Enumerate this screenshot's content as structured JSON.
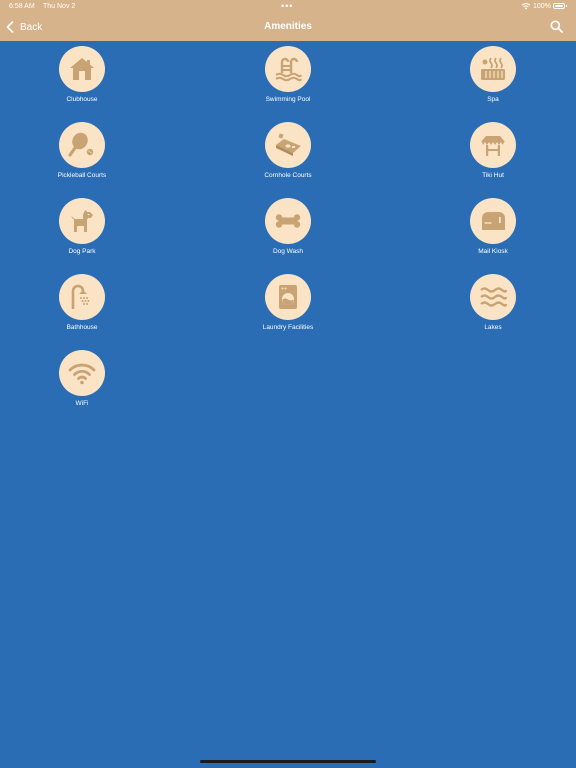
{
  "status": {
    "time": "6:58 AM",
    "date": "Thu Nov 2",
    "battery": "100%"
  },
  "nav": {
    "back_label": "Back",
    "title": "Amenities"
  },
  "colors": {
    "header_bg": "#d6b38a",
    "page_bg": "#2a6db5",
    "icon_circle": "#fbe3c6",
    "icon_fill": "#c8a374"
  },
  "amenities": [
    {
      "label": "Clubhouse",
      "icon": "house-icon"
    },
    {
      "label": "Swimming Pool",
      "icon": "pool-icon"
    },
    {
      "label": "Spa",
      "icon": "hot-tub-icon"
    },
    {
      "label": "Pickleball Courts",
      "icon": "paddle-icon"
    },
    {
      "label": "Cornhole Courts",
      "icon": "cornhole-icon"
    },
    {
      "label": "Tiki Hut",
      "icon": "hut-icon"
    },
    {
      "label": "Dog Park",
      "icon": "dog-icon"
    },
    {
      "label": "Dog Wash",
      "icon": "bone-icon"
    },
    {
      "label": "Mail Kiosk",
      "icon": "mailbox-icon"
    },
    {
      "label": "Bathhouse",
      "icon": "shower-icon"
    },
    {
      "label": "Laundry Facilities",
      "icon": "washer-icon"
    },
    {
      "label": "Lakes",
      "icon": "waves-icon"
    },
    {
      "label": "WiFi",
      "icon": "wifi-icon"
    }
  ]
}
